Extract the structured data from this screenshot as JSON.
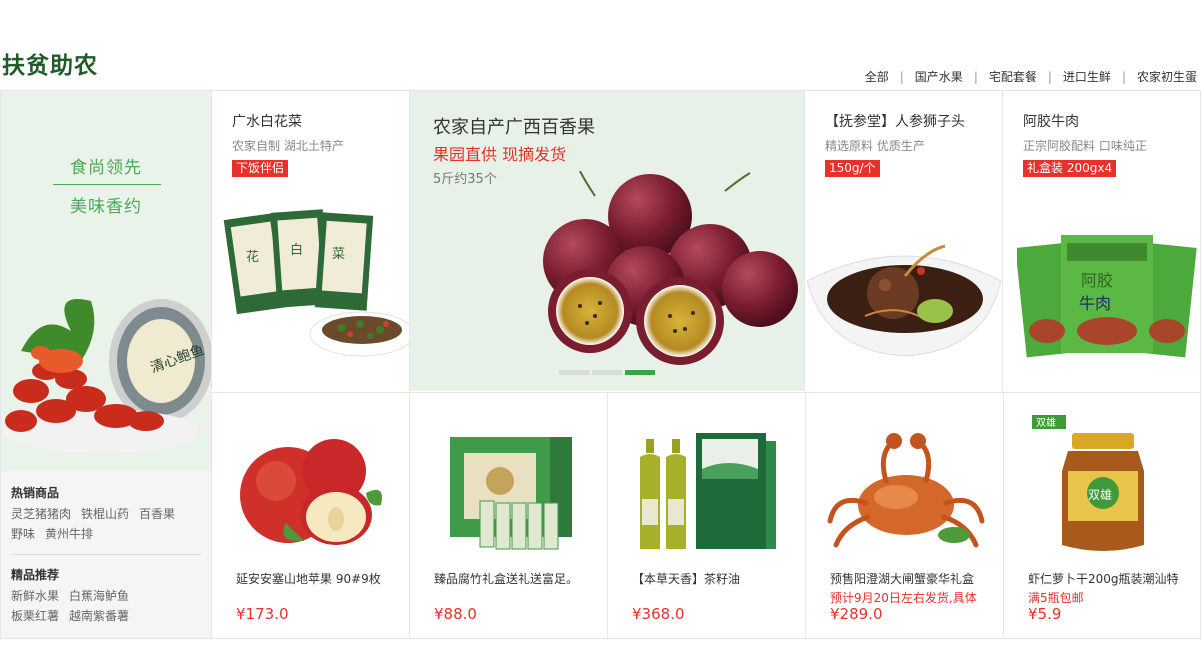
{
  "section": {
    "title": "扶贫助农"
  },
  "category_nav": [
    "全部",
    "国产水果",
    "宅配套餐",
    "进口生鲜",
    "农家初生蛋"
  ],
  "left_banner": {
    "slogan_top": "食尚领先",
    "slogan_bottom": "美味香约"
  },
  "hot": {
    "heading": "热销商品",
    "row1": [
      "灵芝猪猪肉",
      "铁棍山药",
      "百香果"
    ],
    "row2": [
      "野味",
      "黄州牛排"
    ]
  },
  "featured": {
    "heading": "精品推荐",
    "row1": [
      "新鲜水果",
      "白蕉海鲈鱼"
    ],
    "row2": [
      "板栗红薯",
      "越南紫番薯"
    ]
  },
  "top_products": [
    {
      "name": "广水白花菜",
      "desc": "农家自制 湖北土特产",
      "tag": "下饭伴侣",
      "icon": "pickled-vegetable-packs"
    },
    {
      "name": "【抚参堂】人参狮子头",
      "desc": "精选原料 优质生产",
      "tag": "150g/个",
      "icon": "ginseng-meatball-bowl"
    },
    {
      "name": "阿胶牛肉",
      "desc": "正宗阿胶配料 口味纯正",
      "tag": "礼盒装 200gx4",
      "icon": "beef-snack-packs"
    }
  ],
  "feature": {
    "title": "农家自产广西百香果",
    "subtitle": "果园直供 现摘发货",
    "quantity": "5斤约35个",
    "icon": "passion-fruit",
    "slides": 3,
    "active_slide": 3
  },
  "bottom_products": [
    {
      "name": "延安安塞山地苹果 90#9枚",
      "sub": "",
      "price": "¥173.0",
      "icon": "apple"
    },
    {
      "name": "臻品腐竹礼盒送礼送富足。",
      "sub": "",
      "price": "¥88.0",
      "icon": "tofu-skin-gift-box"
    },
    {
      "name": "【本草天香】茶籽油",
      "sub": "",
      "price": "¥368.0",
      "icon": "camellia-oil-bottles"
    },
    {
      "name": "预售阳澄湖大闸蟹豪华礼盒",
      "sub": "预计9月20日左右发货,具体",
      "price": "¥289.0",
      "icon": "hairy-crab"
    },
    {
      "name": "虾仁萝卜干200g瓶装潮汕特",
      "sub": "满5瓶包邮",
      "price": "¥5.9",
      "icon": "pickle-jar",
      "brand": "双雄"
    }
  ],
  "colors": {
    "brand_green": "#1f5c28",
    "accent_green": "#39a548",
    "price_red": "#e8312a"
  }
}
